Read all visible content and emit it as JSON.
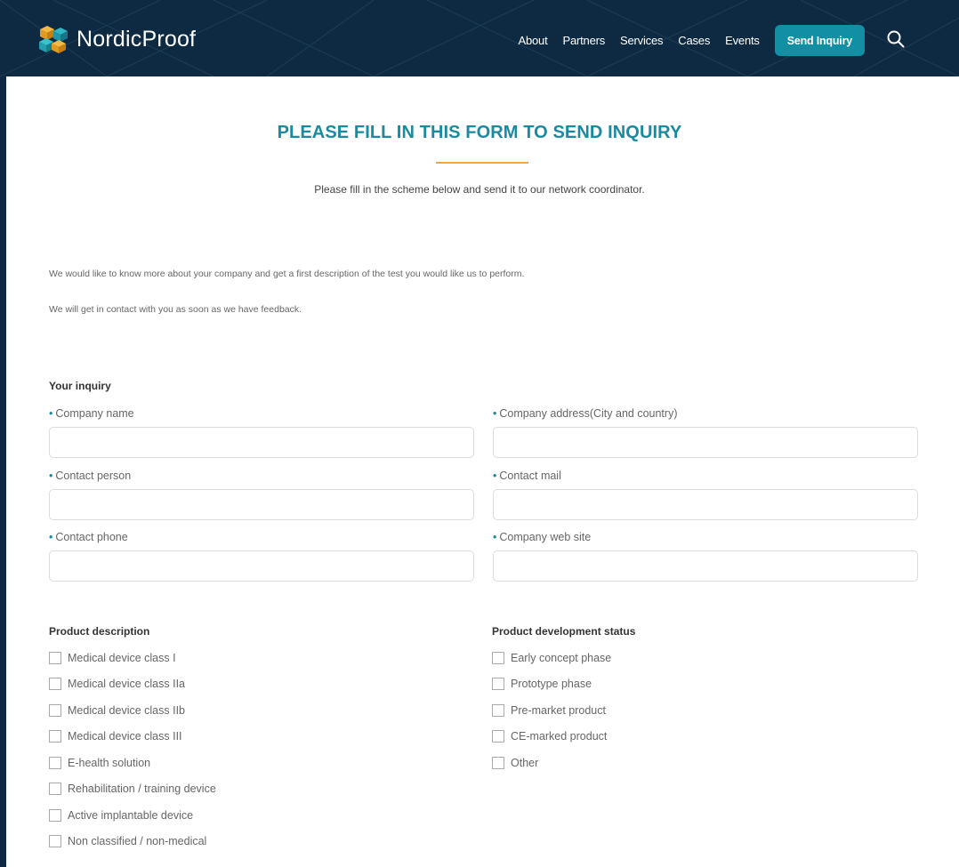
{
  "header": {
    "brand": "NordicProof",
    "nav": [
      "About",
      "Partners",
      "Services",
      "Cases",
      "Events"
    ],
    "cta_label": "Send Inquiry",
    "colors": {
      "background": "#0d2a42",
      "cta": "#128fa3"
    }
  },
  "main": {
    "title": "PLEASE FILL IN THIS FORM TO SEND INQUIRY",
    "subtitle": "Please fill in the scheme below and send it to our network coordinator.",
    "intro_1": "We would like to know more about your company and get a first description of the test you would like us to perform.",
    "intro_2": "We will get in contact with you as soon as we have feedback.",
    "inquiry": {
      "heading": "Your inquiry",
      "fields": [
        {
          "label": "Company name",
          "value": ""
        },
        {
          "label": "Company address(City and country)",
          "value": ""
        },
        {
          "label": "Contact person",
          "value": ""
        },
        {
          "label": "Contact mail",
          "value": ""
        },
        {
          "label": "Contact phone",
          "value": ""
        },
        {
          "label": "Company web site",
          "value": ""
        }
      ]
    },
    "product_description": {
      "heading": "Product description",
      "options": [
        "Medical device class I",
        "Medical device class IIa",
        "Medical device class IIb",
        "Medical device class III",
        "E-health solution",
        "Rehabilitation / training device",
        "Active implantable device",
        "Non classified / non-medical"
      ]
    },
    "development_status": {
      "heading": "Product development status",
      "options": [
        "Early concept phase",
        "Prototype phase",
        "Pre-market product",
        "CE-marked product",
        "Other"
      ]
    },
    "colors": {
      "accent": "#1a8aa1",
      "rule": "#f0a83b"
    }
  }
}
